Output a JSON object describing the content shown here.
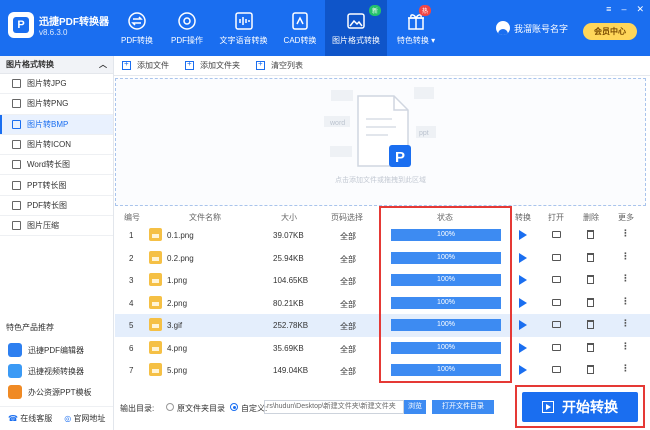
{
  "app": {
    "name": "迅捷PDF转换器",
    "version": "v8.6.3.0"
  },
  "nav": [
    {
      "label": "PDF转换",
      "icon": "swap-icon"
    },
    {
      "label": "PDF操作",
      "icon": "settings-icon"
    },
    {
      "label": "文字语音转换",
      "icon": "audio-wave-icon"
    },
    {
      "label": "CAD转换",
      "icon": "cad-icon"
    },
    {
      "label": "图片格式转换",
      "icon": "image-icon",
      "badge": "新",
      "active": true
    },
    {
      "label": "特色转换",
      "icon": "gift-icon",
      "badge": "热"
    }
  ],
  "user": {
    "name": "我溜账号名字",
    "vip_label": "会员中心"
  },
  "window_controls": [
    "≡",
    "–",
    "✕"
  ],
  "sidebar": {
    "header": "图片格式转换",
    "items": [
      {
        "label": "图片转JPG"
      },
      {
        "label": "图片转PNG"
      },
      {
        "label": "图片转BMP",
        "active": true
      },
      {
        "label": "图片转ICON"
      },
      {
        "label": "Word转长图"
      },
      {
        "label": "PPT转长图"
      },
      {
        "label": "PDF转长图"
      },
      {
        "label": "图片压缩"
      }
    ],
    "featured_title": "特色产品推荐",
    "featured": [
      {
        "label": "迅捷PDF编辑器"
      },
      {
        "label": "迅捷视频转换器"
      },
      {
        "label": "办公资源PPT模板"
      }
    ],
    "bottom": {
      "service": "在线客服",
      "website": "官网地址"
    }
  },
  "toolbar": {
    "add_file": "添加文件",
    "add_folder": "添加文件夹",
    "clear": "清空列表"
  },
  "drop_zone": {
    "hint": "点击添加文件或拖拽到此区域",
    "doc_tags": [
      "word",
      "ppt",
      "excel",
      "pdf",
      "txt"
    ]
  },
  "table": {
    "headers": {
      "index": "编号",
      "name": "文件名称",
      "size": "大小",
      "pages": "页码选择",
      "status": "状态",
      "convert": "转换",
      "open": "打开",
      "delete": "删除",
      "more": "更多"
    },
    "rows": [
      {
        "index": "1",
        "name": "0.1.png",
        "size": "39.07KB",
        "pages": "全部",
        "status": "100%",
        "progress": 1.0
      },
      {
        "index": "2",
        "name": "0.2.png",
        "size": "25.94KB",
        "pages": "全部",
        "status": "100%",
        "progress": 1.0
      },
      {
        "index": "3",
        "name": "1.png",
        "size": "104.65KB",
        "pages": "全部",
        "status": "100%",
        "progress": 1.0
      },
      {
        "index": "4",
        "name": "2.png",
        "size": "80.21KB",
        "pages": "全部",
        "status": "100%",
        "progress": 1.0
      },
      {
        "index": "5",
        "name": "3.gif",
        "size": "252.78KB",
        "pages": "全部",
        "status": "100%",
        "progress": 1.0,
        "selected": true
      },
      {
        "index": "6",
        "name": "4.png",
        "size": "35.69KB",
        "pages": "全部",
        "status": "100%",
        "progress": 1.0
      },
      {
        "index": "7",
        "name": "5.png",
        "size": "149.04KB",
        "pages": "全部",
        "status": "100%",
        "progress": 1.0
      }
    ]
  },
  "footer": {
    "output_label": "输出目录:",
    "opt_original": "原文件夹目录",
    "opt_custom": "自定义:",
    "path": "rs\\hudun\\Desktop\\新建文件夹\\新建文件夹",
    "browse": "浏览",
    "open_folder": "打开文件目录"
  },
  "start_button": "开始转换",
  "colors": {
    "primary": "#1a6ef0",
    "progress": "#3d8bf2",
    "highlight_border": "#e53935",
    "vip": "#ffd65a"
  }
}
